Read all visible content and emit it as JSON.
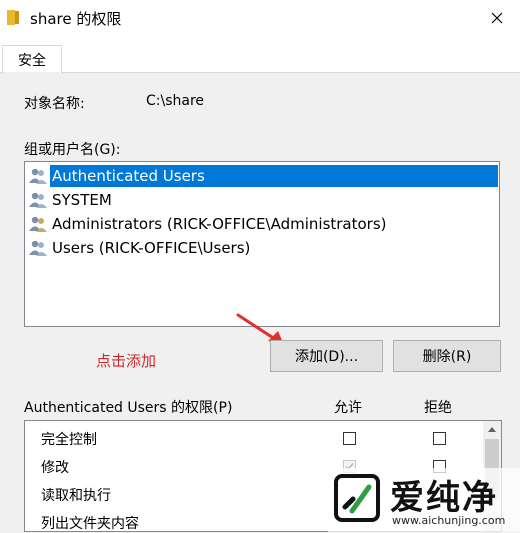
{
  "window": {
    "title": "share 的权限"
  },
  "tabs": [
    {
      "label": "安全"
    }
  ],
  "object": {
    "label": "对象名称:",
    "value": "C:\\share"
  },
  "groups": {
    "label": "组或用户名(G):",
    "items": [
      {
        "label": "Authenticated Users",
        "selected": true
      },
      {
        "label": "SYSTEM",
        "selected": false
      },
      {
        "label": "Administrators (RICK-OFFICE\\Administrators)",
        "selected": false
      },
      {
        "label": "Users (RICK-OFFICE\\Users)",
        "selected": false
      }
    ]
  },
  "hint": "点击添加",
  "buttons": {
    "add": "添加(D)...",
    "remove": "删除(R)"
  },
  "permissions": {
    "title": "Authenticated Users 的权限(P)",
    "allow_header": "允许",
    "deny_header": "拒绝",
    "rows": [
      {
        "label": "完全控制",
        "allow": "unchecked",
        "deny": "unchecked"
      },
      {
        "label": "修改",
        "allow": "checked-disabled",
        "deny": "unchecked"
      },
      {
        "label": "读取和执行",
        "allow": "",
        "deny": ""
      },
      {
        "label": "列出文件夹内容",
        "allow": "",
        "deny": ""
      }
    ]
  },
  "watermark": {
    "brand": "爱纯净",
    "url": "www.aichunjing.com"
  },
  "colors": {
    "selection": "#0078d7",
    "hint": "#cc2a2a"
  }
}
